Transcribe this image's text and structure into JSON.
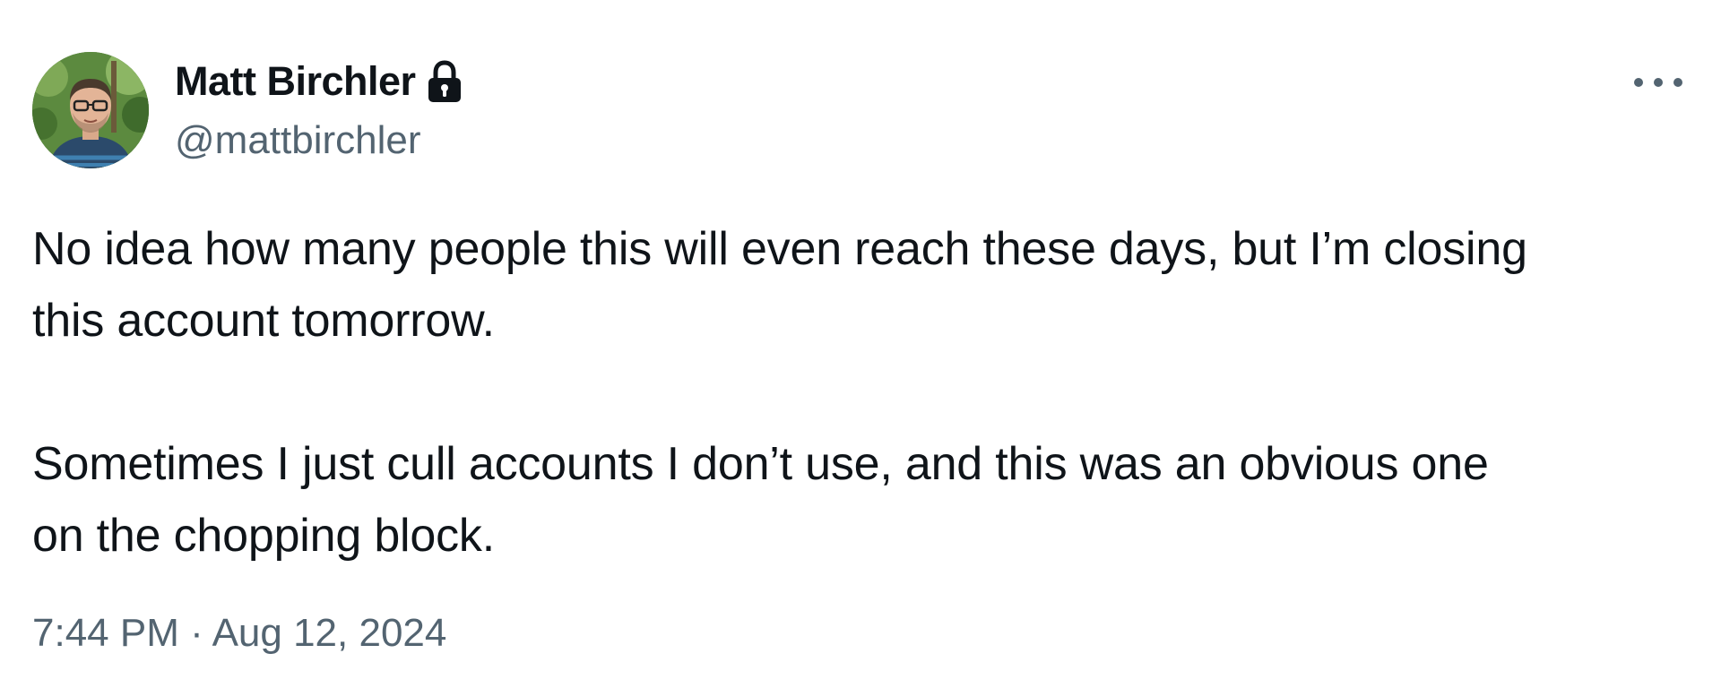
{
  "tweet": {
    "author": {
      "display_name": "Matt Birchler",
      "handle": "@mattbirchler",
      "avatar_icon": "avatar-photo",
      "protected_icon": "lock-icon"
    },
    "more_icon": "more-horizontal-icon",
    "body": {
      "paragraph_1_line_1": "No idea how many people this will even reach these days, but I’m closing",
      "paragraph_1_line_2": "this account tomorrow.",
      "paragraph_2_line_1": "Sometimes I just cull accounts I don’t use, and this was an obvious one",
      "paragraph_2_line_2": "on the chopping block."
    },
    "meta": {
      "time": "7:44 PM",
      "separator": "·",
      "date": "Aug 12, 2024"
    }
  },
  "colors": {
    "text_primary": "#0f1419",
    "text_secondary": "#536471",
    "background": "#ffffff"
  }
}
